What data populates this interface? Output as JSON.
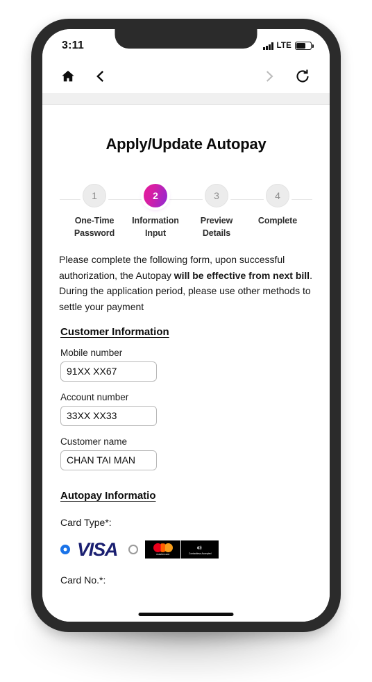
{
  "status_bar": {
    "time": "3:11",
    "network_label": "LTE",
    "signal_icon": "signal-bars-icon",
    "battery_icon": "battery-icon",
    "battery_level_pct": 58
  },
  "browser": {
    "home_icon": "home-icon",
    "back_icon": "chevron-left-icon",
    "forward_icon": "chevron-right-icon",
    "reload_icon": "reload-icon",
    "forward_enabled": false
  },
  "page": {
    "title": "Apply/Update Autopay",
    "stepper": {
      "active_step": 2,
      "active_color_start": "#e6189a",
      "active_color_end": "#8d2ad6",
      "steps": [
        {
          "number": "1",
          "label": "One-Time\nPassword"
        },
        {
          "number": "2",
          "label": "Information\nInput"
        },
        {
          "number": "3",
          "label": "Preview\nDetails"
        },
        {
          "number": "4",
          "label": "Complete"
        }
      ]
    },
    "intro": {
      "part1": "Please complete the following form,  upon successful authorization, the Autopay ",
      "bold": "will be effective from next bill",
      "part2": ". During the application period, please use other methods to settle your payment"
    },
    "customer_section": {
      "heading": "Customer Information",
      "fields": [
        {
          "label": "Mobile number",
          "value": "91XX XX67"
        },
        {
          "label": "Account number",
          "value": "33XX XX33"
        },
        {
          "label": "Customer name",
          "value": "CHAN TAI MAN"
        }
      ]
    },
    "autopay_section": {
      "heading": "Autopay Informatio",
      "card_type_label": "Card Type*:",
      "card_options": [
        {
          "name": "visa",
          "logo_text": "VISA",
          "selected": true
        },
        {
          "name": "mastercard",
          "logo_text": "mastercard",
          "contactless_text": "Contactless\nAccepted",
          "selected": false
        }
      ],
      "card_no_label": "Card No.*:"
    }
  }
}
